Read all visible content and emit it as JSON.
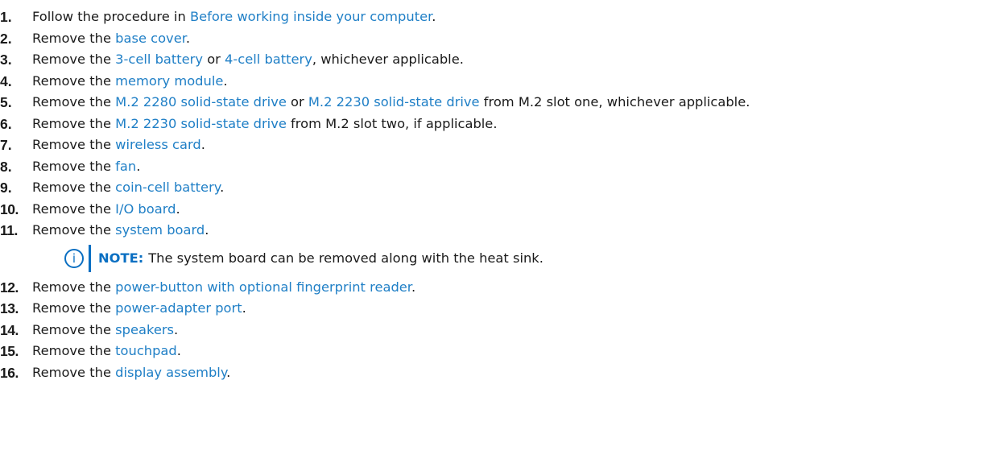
{
  "steps": [
    {
      "num": "1.",
      "parts": [
        {
          "t": "Follow the procedure in "
        },
        {
          "t": "Before working inside your computer",
          "link": true
        },
        {
          "t": "."
        }
      ]
    },
    {
      "num": "2.",
      "parts": [
        {
          "t": "Remove the "
        },
        {
          "t": "base cover",
          "link": true
        },
        {
          "t": "."
        }
      ]
    },
    {
      "num": "3.",
      "parts": [
        {
          "t": "Remove the "
        },
        {
          "t": "3-cell battery",
          "link": true
        },
        {
          "t": " or "
        },
        {
          "t": "4-cell battery",
          "link": true
        },
        {
          "t": ", whichever applicable."
        }
      ]
    },
    {
      "num": "4.",
      "parts": [
        {
          "t": "Remove the "
        },
        {
          "t": "memory module",
          "link": true
        },
        {
          "t": "."
        }
      ]
    },
    {
      "num": "5.",
      "parts": [
        {
          "t": "Remove the "
        },
        {
          "t": "M.2 2280 solid-state drive",
          "link": true
        },
        {
          "t": " or "
        },
        {
          "t": "M.2 2230 solid-state drive",
          "link": true
        },
        {
          "t": " from M.2 slot one, whichever applicable."
        }
      ]
    },
    {
      "num": "6.",
      "parts": [
        {
          "t": "Remove the "
        },
        {
          "t": "M.2 2230 solid-state drive",
          "link": true
        },
        {
          "t": " from M.2 slot two, if applicable."
        }
      ]
    },
    {
      "num": "7.",
      "parts": [
        {
          "t": "Remove the "
        },
        {
          "t": "wireless card",
          "link": true
        },
        {
          "t": "."
        }
      ]
    },
    {
      "num": "8.",
      "parts": [
        {
          "t": "Remove the "
        },
        {
          "t": "fan",
          "link": true
        },
        {
          "t": "."
        }
      ]
    },
    {
      "num": "9.",
      "parts": [
        {
          "t": "Remove the "
        },
        {
          "t": "coin-cell battery",
          "link": true
        },
        {
          "t": "."
        }
      ]
    },
    {
      "num": "10.",
      "parts": [
        {
          "t": "Remove the "
        },
        {
          "t": "I/O board",
          "link": true
        },
        {
          "t": "."
        }
      ]
    },
    {
      "num": "11.",
      "parts": [
        {
          "t": "Remove the "
        },
        {
          "t": "system board",
          "link": true
        },
        {
          "t": "."
        }
      ],
      "note": {
        "label": "NOTE:",
        "text": "The system board can be removed along with the heat sink."
      }
    },
    {
      "num": "12.",
      "parts": [
        {
          "t": "Remove the "
        },
        {
          "t": "power-button with optional fingerprint reader",
          "link": true
        },
        {
          "t": "."
        }
      ]
    },
    {
      "num": "13.",
      "parts": [
        {
          "t": "Remove the "
        },
        {
          "t": "power-adapter port",
          "link": true
        },
        {
          "t": "."
        }
      ]
    },
    {
      "num": "14.",
      "parts": [
        {
          "t": "Remove the "
        },
        {
          "t": "speakers",
          "link": true
        },
        {
          "t": "."
        }
      ]
    },
    {
      "num": "15.",
      "parts": [
        {
          "t": "Remove the "
        },
        {
          "t": "touchpad",
          "link": true
        },
        {
          "t": "."
        }
      ]
    },
    {
      "num": "16.",
      "parts": [
        {
          "t": "Remove the "
        },
        {
          "t": "display assembly",
          "link": true
        },
        {
          "t": "."
        }
      ]
    }
  ],
  "icons": {
    "note": "info-icon",
    "note_glyph": "i"
  },
  "colors": {
    "link": "#1f7fc6",
    "note_accent": "#0a6fc2",
    "text": "#1a1a1a"
  }
}
